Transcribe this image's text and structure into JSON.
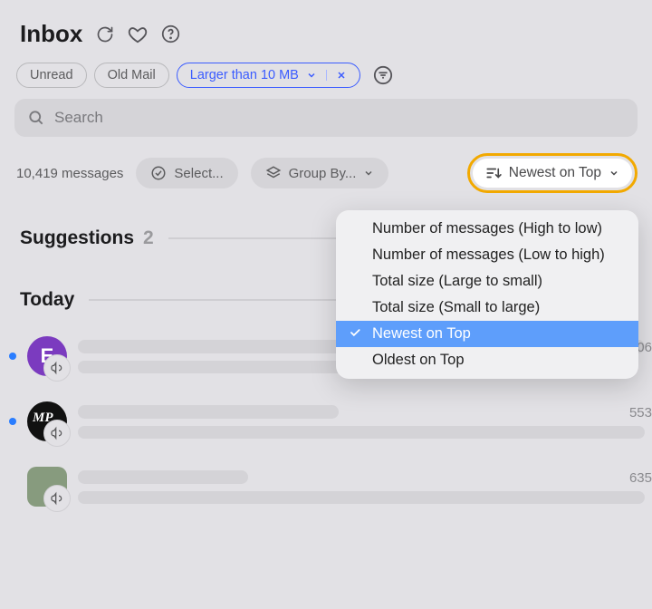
{
  "title": "Inbox",
  "filter_chips": {
    "unread": "Unread",
    "old_mail": "Old Mail",
    "active": "Larger than 10 MB"
  },
  "search_placeholder": "Search",
  "message_count_text": "10,419 messages",
  "controls": {
    "select": "Select...",
    "group_by": "Group By...",
    "sort": "Newest on Top"
  },
  "sections": {
    "suggestions": {
      "label": "Suggestions",
      "count": "2"
    },
    "today": {
      "label": "Today"
    }
  },
  "rows": [
    {
      "num": "306"
    },
    {
      "num": "553"
    },
    {
      "num": "635"
    }
  ],
  "avatar_letter": "E",
  "avatar_mp": "MP",
  "sort_menu": [
    "Number of messages (High to low)",
    "Number of messages (Low to high)",
    "Total size (Large to small)",
    "Total size (Small to large)",
    "Newest on Top",
    "Oldest on Top"
  ],
  "sort_selected_index": 4
}
